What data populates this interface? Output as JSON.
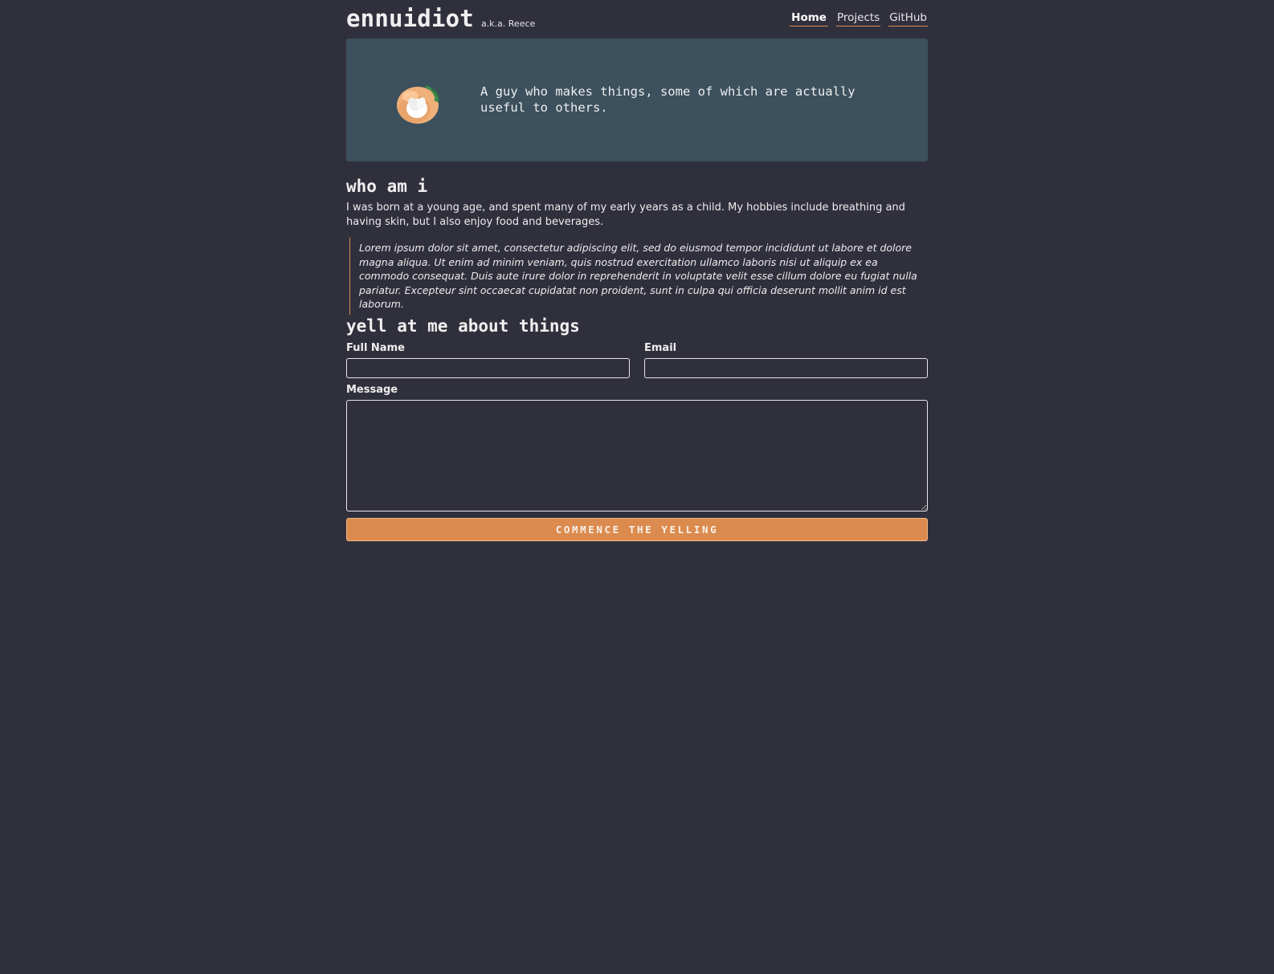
{
  "header": {
    "brand_name": "ennuidiot",
    "brand_aka": "a.k.a. Reece",
    "nav": [
      {
        "label": "Home",
        "active": true
      },
      {
        "label": "Projects",
        "active": false
      },
      {
        "label": "GitHub",
        "active": false
      }
    ]
  },
  "hero": {
    "avatar_icon": "peach-egg-avatar-icon",
    "tagline": "A guy who makes things, some of which are actually useful to others."
  },
  "about": {
    "title": "who am i",
    "body": "I was born at a young age, and spent many of my early years as a child. My hobbies include breathing and having skin, but I also enjoy food and beverages.",
    "quote": "Lorem ipsum dolor sit amet, consectetur adipiscing elit, sed do eiusmod tempor incididunt ut labore et dolore magna aliqua. Ut enim ad minim veniam, quis nostrud exercitation ullamco laboris nisi ut aliquip ex ea commodo consequat. Duis aute irure dolor in reprehenderit in voluptate velit esse cillum dolore eu fugiat nulla pariatur. Excepteur sint occaecat cupidatat non proident, sunt in culpa qui officia deserunt mollit anim id est laborum."
  },
  "contact": {
    "title": "yell at me about things",
    "full_name_label": "Full Name",
    "full_name_value": "",
    "email_label": "Email",
    "email_value": "",
    "message_label": "Message",
    "message_value": "",
    "submit_label": "COMMENCE THE YELLING"
  },
  "colors": {
    "background": "#30303d",
    "hero_background": "#3c505d",
    "accent": "#dc8b4e"
  }
}
